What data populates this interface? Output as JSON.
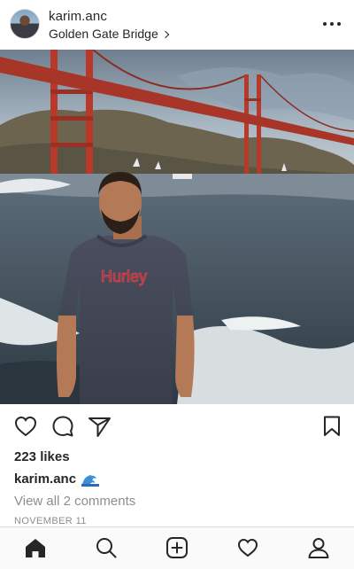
{
  "post": {
    "username": "karim.anc",
    "location": "Golden Gate Bridge",
    "photo_shirt_text": "Hurley",
    "likes": "223 likes",
    "caption_user": "karim.anc",
    "caption_emoji": "wave-emoji",
    "comments_link": "View all 2 comments",
    "date": "NOVEMBER 11"
  },
  "icons": {
    "like": "heart-icon",
    "comment": "comment-icon",
    "share": "send-icon",
    "save": "bookmark-icon",
    "more": "more-horizontal-icon"
  },
  "tabbar": {
    "items": [
      "home-icon",
      "search-icon",
      "new-post-icon",
      "activity-icon",
      "profile-icon"
    ],
    "active": "home"
  },
  "colors": {
    "text": "#262626",
    "muted": "#8e8e8e",
    "bridge": "#b8392a"
  }
}
